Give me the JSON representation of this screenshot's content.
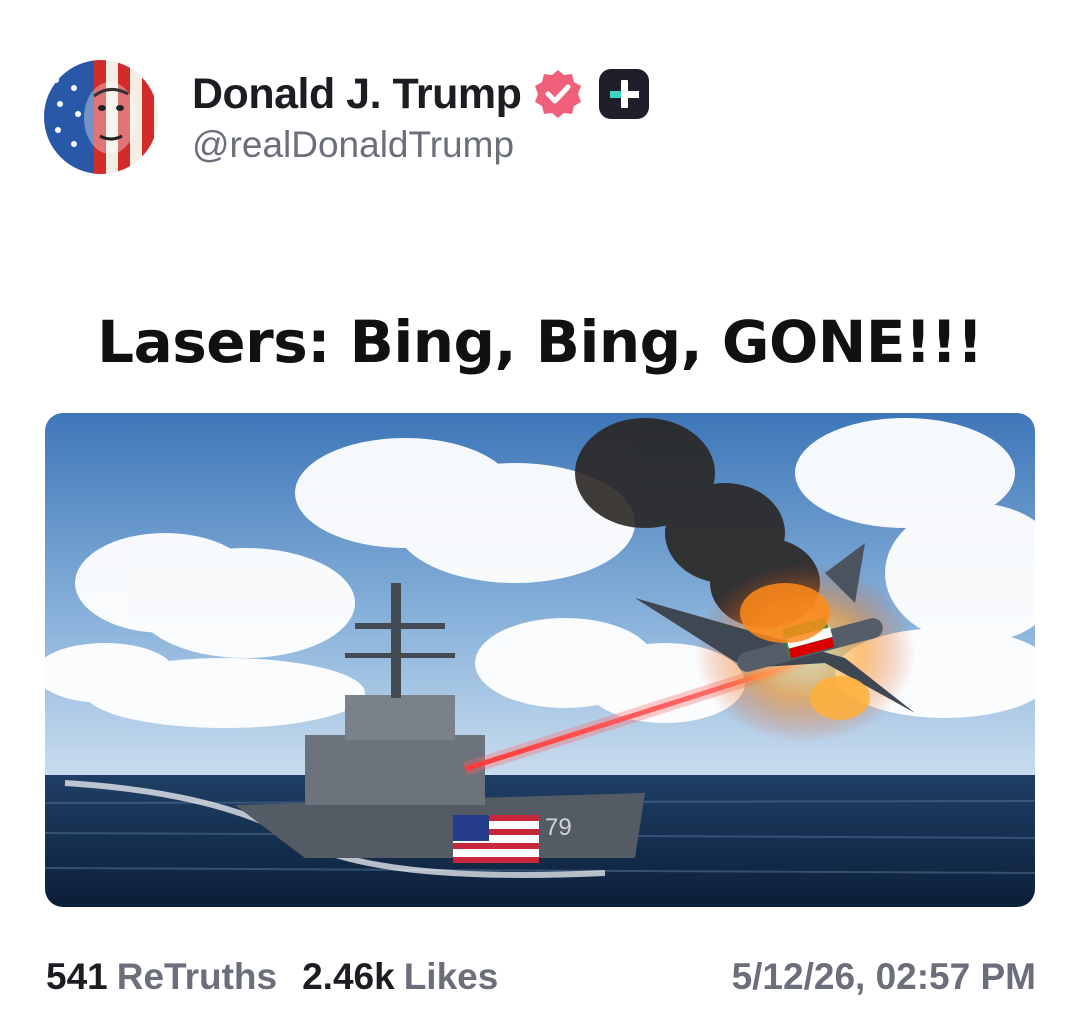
{
  "post": {
    "author": {
      "display_name": "Donald J. Trump",
      "handle": "@realDonaldTrump",
      "avatar_icon": "flag-portrait-avatar",
      "verified_icon": "verified-badge-icon",
      "verified_color": "#f0607a",
      "plus_icon": "truth-plus-icon"
    },
    "title": "Lasers: Bing, Bing, GONE!!!",
    "media": {
      "description_icon": "warship-laser-drone-image",
      "ship_hull_number": "79"
    },
    "stats": {
      "retruths_count": "541",
      "retruths_label": "ReTruths",
      "likes_count": "2.46k",
      "likes_label": "Likes"
    },
    "timestamp": "5/12/26, 02:57 PM"
  }
}
